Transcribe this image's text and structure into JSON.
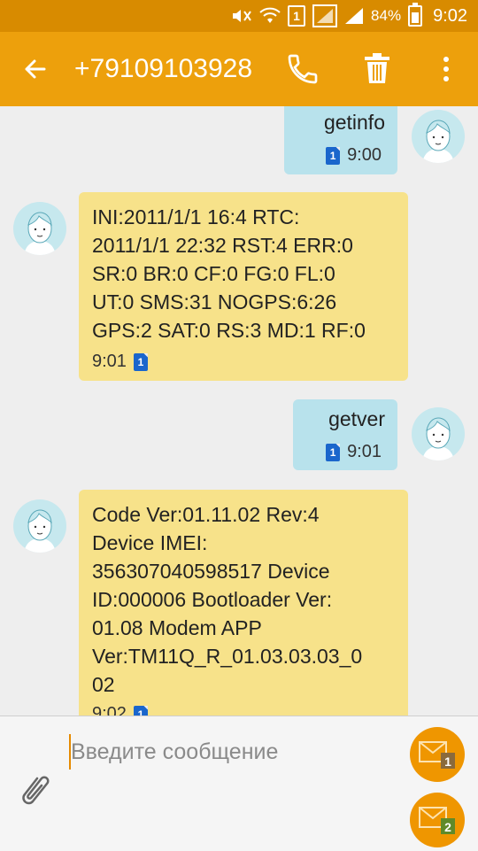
{
  "status_bar": {
    "sim_label": "1",
    "battery": "84%",
    "time": "9:02"
  },
  "header": {
    "title": "+79109103928",
    "back_icon": "back-arrow-icon",
    "call_icon": "phone-icon",
    "delete_icon": "trash-icon",
    "more_icon": "more-vert-icon"
  },
  "messages": [
    {
      "direction": "outgoing",
      "text": "getinfo",
      "sim": "1",
      "time": "9:00"
    },
    {
      "direction": "incoming",
      "text": "INI:2011/1/1 16:4 RTC:\n2011/1/1 22:32 RST:4 ERR:0\nSR:0 BR:0 CF:0 FG:0 FL:0\nUT:0 SMS:31 NOGPS:6:26\nGPS:2 SAT:0 RS:3 MD:1 RF:0",
      "sim": "1",
      "time": "9:01"
    },
    {
      "direction": "outgoing",
      "text": "getver",
      "sim": "1",
      "time": "9:01"
    },
    {
      "direction": "incoming",
      "text": "Code Ver:01.11.02 Rev:4\nDevice IMEI:\n356307040598517 Device\nID:000006 Bootloader Ver:\n01.08 Modem APP\nVer:TM11Q_R_01.03.03.03_0\n02",
      "sim": "1",
      "time": "9:02"
    }
  ],
  "compose": {
    "placeholder": "Введите сообщение",
    "send_sim1_badge": "1",
    "send_sim2_badge": "2"
  },
  "colors": {
    "action_bar": "#eda00c",
    "status_bar": "#d88b00",
    "outgoing_bubble": "#b8e2ec",
    "incoming_bubble": "#f7e28a",
    "send_button": "#ef9600"
  }
}
